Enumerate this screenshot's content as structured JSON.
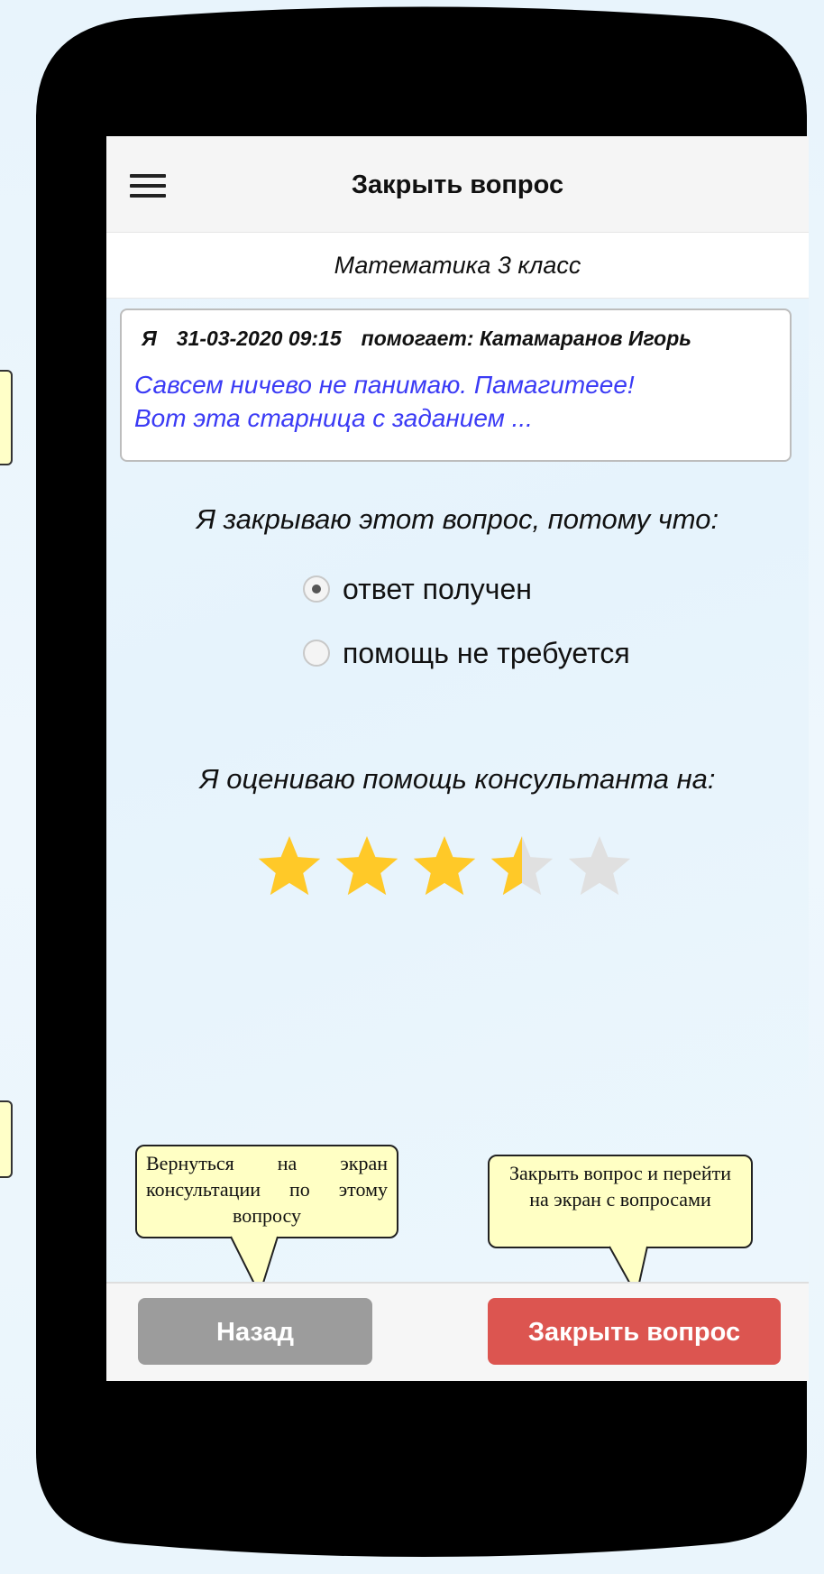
{
  "app": {
    "title": "Закрыть вопрос",
    "subject": "Математика 3 класс"
  },
  "question": {
    "author": "Я",
    "datetime": "31-03-2020 09:15",
    "helper": "помогает: Катамаранов Игорь",
    "text_line1": "Савсем ничево не панимаю. Памагитеее!",
    "text_line2": "Вот эта старница с заданием ..."
  },
  "close_reason": {
    "label": "Я закрываю этот вопрос, потому что:",
    "options": [
      {
        "label": "ответ получен",
        "selected": true
      },
      {
        "label": "помощь не требуется",
        "selected": false
      }
    ]
  },
  "rating": {
    "label": "Я оцениваю помощь консультанта на:",
    "value": 3.5,
    "max": 5,
    "filled_color": "#ffc928",
    "empty_color": "#e0e0e0"
  },
  "buttons": {
    "back": "Назад",
    "close": "Закрыть вопрос"
  },
  "annotations": {
    "back": "Вернуться на экран консультации по этому вопросу",
    "close": "Закрыть вопрос и перейти на экран с вопросами"
  },
  "colors": {
    "back_button": "#9c9c9c",
    "close_button": "#dc5550",
    "question_text": "#3b3bf5",
    "callout": "#ffffc4"
  }
}
